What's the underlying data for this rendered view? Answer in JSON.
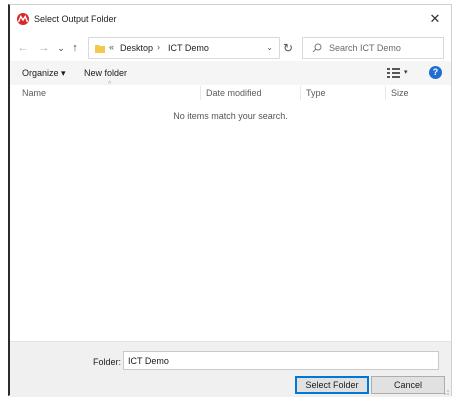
{
  "window": {
    "title": "Select Output Folder",
    "close_label": "✕"
  },
  "nav": {
    "back": "←",
    "forward": "→",
    "recent": "⌄",
    "up": "↑",
    "overflow": "«",
    "breadcrumbs": [
      "Desktop",
      "ICT Demo"
    ],
    "crumb_sep": "›",
    "dropdown": "⌄",
    "refresh": "↻"
  },
  "search": {
    "placeholder": "Search ICT Demo"
  },
  "toolbar": {
    "organize_label": "Organize ▾",
    "new_folder_label": "New folder",
    "view_dropdown": "▾",
    "help_label": "?"
  },
  "columns": {
    "name": "Name",
    "date_modified": "Date modified",
    "type": "Type",
    "size": "Size",
    "sort_indicator": "^"
  },
  "list": {
    "empty_message": "No items match your search."
  },
  "footer": {
    "folder_label": "Folder:",
    "folder_value": "ICT Demo",
    "select_label": "Select Folder",
    "cancel_label": "Cancel"
  },
  "colors": {
    "accent": "#0078d7",
    "help": "#1e6fd1",
    "app_icon": "#d62a2a",
    "folder": "#f2c94c"
  },
  "icons": {
    "app": "app-logo-icon",
    "folder": "folder-icon",
    "search": "search-icon",
    "view": "view-options-icon",
    "help": "help-icon"
  }
}
